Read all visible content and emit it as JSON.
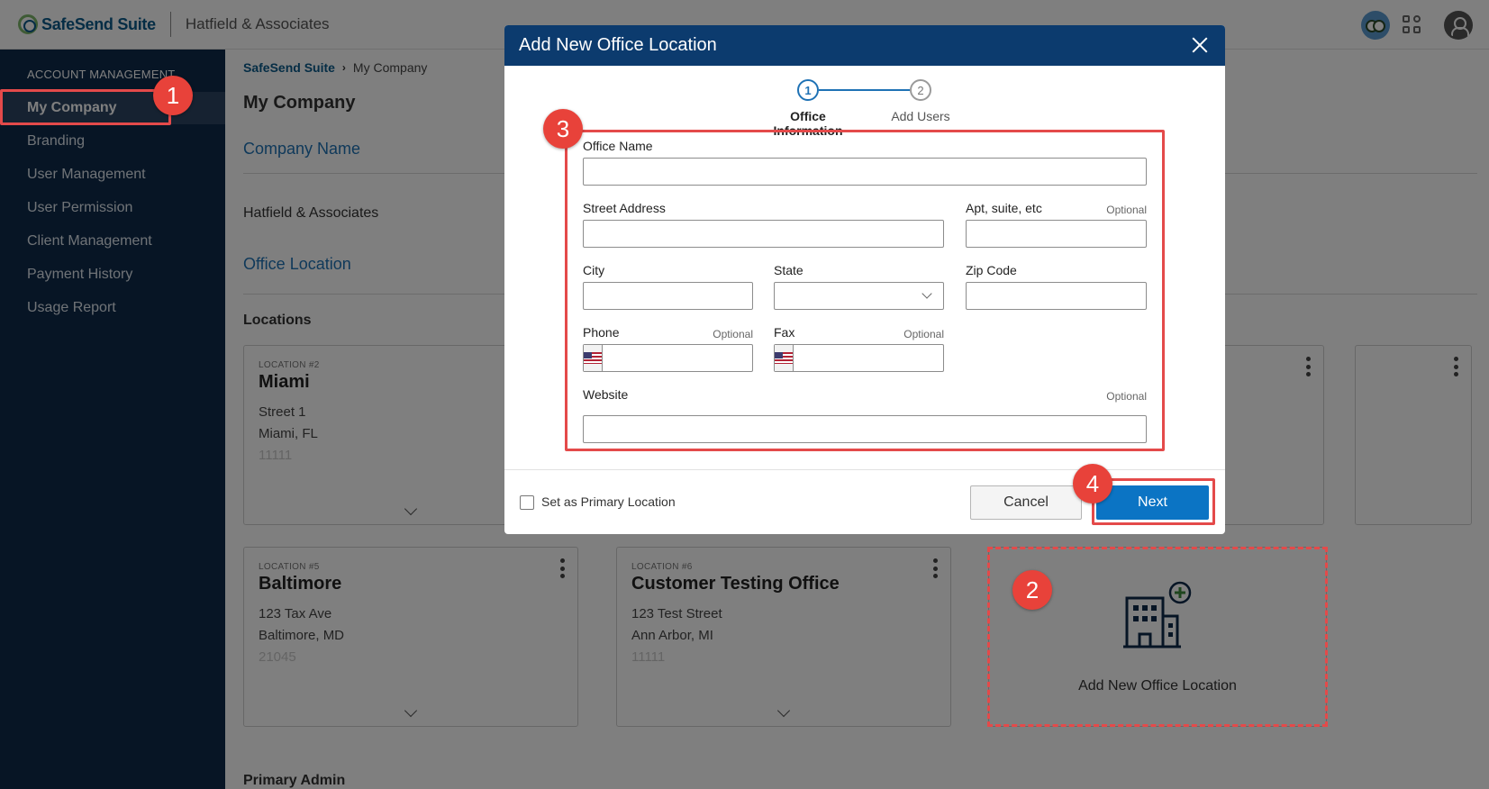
{
  "header": {
    "brand": "SafeSend Suite",
    "company": "Hatfield & Associates"
  },
  "sidebar": {
    "heading": "ACCOUNT MANAGEMENT",
    "items": [
      {
        "label": "My Company",
        "active": true
      },
      {
        "label": "Branding"
      },
      {
        "label": "User Management"
      },
      {
        "label": "User Permission"
      },
      {
        "label": "Client Management"
      },
      {
        "label": "Payment History"
      },
      {
        "label": "Usage Report"
      }
    ]
  },
  "breadcrumb": {
    "root": "SafeSend Suite",
    "current": "My Company"
  },
  "page": {
    "title": "My Company",
    "company_name_section": "Company Name",
    "company_name_value": "Hatfield & Associates",
    "office_location_section": "Office Location",
    "locations_label": "Locations",
    "primary_admin_label": "Primary Admin"
  },
  "locations": [
    {
      "number": "LOCATION #2",
      "name": "Miami",
      "line1": "Street 1",
      "line2": "Miami, FL",
      "line3": "11111"
    },
    {
      "number": "LOCATION #5",
      "name": "Baltimore",
      "line1": "123 Tax Ave",
      "line2": "Baltimore, MD",
      "line3": "21045"
    },
    {
      "number": "LOCATION #6",
      "name": "Customer Testing Office",
      "line1": "123 Test Street",
      "line2": "Ann Arbor, MI",
      "line3": "11111"
    }
  ],
  "add_location": {
    "label": "Add New Office Location"
  },
  "modal": {
    "title": "Add New Office Location",
    "steps": [
      {
        "number": "1",
        "label": "Office Information",
        "active": true
      },
      {
        "number": "2",
        "label": "Add Users",
        "active": false
      }
    ],
    "fields": {
      "office_name": {
        "label": "Office Name",
        "value": ""
      },
      "street_address": {
        "label": "Street Address",
        "value": ""
      },
      "apt": {
        "label": "Apt, suite, etc",
        "optional": "Optional",
        "value": ""
      },
      "city": {
        "label": "City",
        "value": ""
      },
      "state": {
        "label": "State",
        "value": ""
      },
      "zip": {
        "label": "Zip Code",
        "value": ""
      },
      "phone": {
        "label": "Phone",
        "optional": "Optional",
        "value": ""
      },
      "fax": {
        "label": "Fax",
        "optional": "Optional",
        "value": ""
      },
      "website": {
        "label": "Website",
        "optional": "Optional",
        "value": ""
      }
    },
    "primary_checkbox_label": "Set as Primary Location",
    "cancel_label": "Cancel",
    "next_label": "Next"
  },
  "annotations": [
    "1",
    "2",
    "3",
    "4"
  ],
  "colors": {
    "sidebar_bg": "#0e2a4a",
    "modal_header_bg": "#0c3b6e",
    "accent_blue": "#1f72b5",
    "next_button": "#0b74c4",
    "annotation_red": "#e8423a",
    "add_icon_plus": "#3d8b3d"
  },
  "icons": [
    "close-icon",
    "chevron-down-icon",
    "kebab-menu-icon",
    "us-flag-icon",
    "building-add-icon",
    "apps-grid-icon",
    "user-avatar-icon",
    "owl-avatar-icon"
  ]
}
